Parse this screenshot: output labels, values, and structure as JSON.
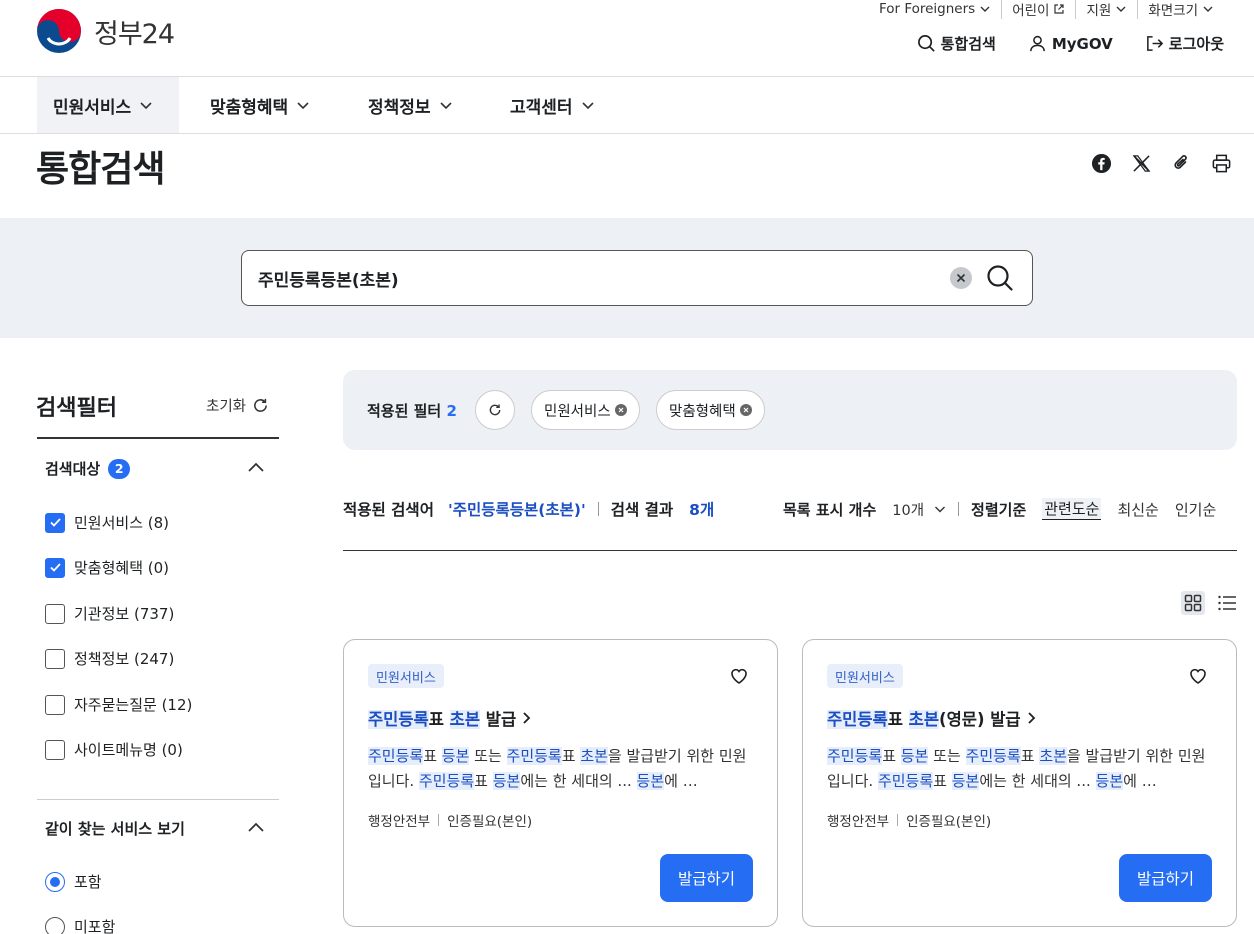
{
  "header": {
    "logo_text": "정부24",
    "utility": [
      "For Foreigners",
      "어린이",
      "지원",
      "화면크기"
    ],
    "top_nav": [
      "통합검색",
      "MyGOV",
      "로그아웃"
    ]
  },
  "gnb": [
    "민원서비스",
    "맞춤형혜택",
    "정책정보",
    "고객센터"
  ],
  "page_title": "통합검색",
  "search": {
    "value": "주민등록등본(초본)"
  },
  "sidebar": {
    "title": "검색필터",
    "reset_label": "초기화",
    "target_section": {
      "label": "검색대상",
      "count": "2",
      "options": [
        {
          "label": "민원서비스 (8)",
          "checked": true
        },
        {
          "label": "맞춤형혜택 (0)",
          "checked": true
        },
        {
          "label": "기관정보 (737)",
          "checked": false
        },
        {
          "label": "정책정보 (247)",
          "checked": false
        },
        {
          "label": "자주묻는질문 (12)",
          "checked": false
        },
        {
          "label": "사이트메뉴명 (0)",
          "checked": false
        }
      ]
    },
    "together_section": {
      "label": "같이 찾는 서비스 보기",
      "options": [
        {
          "label": "포함",
          "checked": true
        },
        {
          "label": "미포함",
          "checked": false
        }
      ]
    }
  },
  "applied_filters": {
    "label": "적용된 필터",
    "count": "2",
    "chips": [
      "민원서비스",
      "맞춤형혜택"
    ]
  },
  "result_meta": {
    "keyword_label": "적용된 검색어",
    "keyword": "'주민등록등본(초본)'",
    "result_label": "검색 결과",
    "result_count": "8개",
    "list_count_label": "목록 표시 개수",
    "list_count_value": "10개",
    "sort_label": "정렬기준",
    "sort_options": [
      "관련도순",
      "최신순",
      "인기순"
    ],
    "active_sort": "관련도순"
  },
  "cards": [
    {
      "tag": "민원서비스",
      "title_parts": [
        [
          "주민등록",
          true
        ],
        [
          "표 ",
          false
        ],
        [
          "초본",
          true
        ],
        [
          " 발급",
          false
        ]
      ],
      "desc_parts": [
        [
          "주민등록",
          true
        ],
        [
          "표 ",
          false
        ],
        [
          "등본",
          true
        ],
        [
          " 또는 ",
          false
        ],
        [
          "주민등록",
          true
        ],
        [
          "표 ",
          false
        ],
        [
          "초본",
          true
        ],
        [
          "을 발급받기 위한 민원입니다. ",
          false
        ],
        [
          "주민등록",
          true
        ],
        [
          "표 ",
          false
        ],
        [
          "등본",
          true
        ],
        [
          "에는 한 세대의 ... ",
          false
        ],
        [
          "등본",
          true
        ],
        [
          "에 …",
          false
        ]
      ],
      "agency": "행정안전부",
      "auth": "인증필요(본인)",
      "button": "발급하기"
    },
    {
      "tag": "민원서비스",
      "title_parts": [
        [
          "주민등록",
          true
        ],
        [
          "표 ",
          false
        ],
        [
          "초본",
          true
        ],
        [
          "(영문) 발급",
          false
        ]
      ],
      "desc_parts": [
        [
          "주민등록",
          true
        ],
        [
          "표 ",
          false
        ],
        [
          "등본",
          true
        ],
        [
          " 또는 ",
          false
        ],
        [
          "주민등록",
          true
        ],
        [
          "표 ",
          false
        ],
        [
          "초본",
          true
        ],
        [
          "을 발급받기 위한 민원입니다. ",
          false
        ],
        [
          "주민등록",
          true
        ],
        [
          "표 ",
          false
        ],
        [
          "등본",
          true
        ],
        [
          "에는 한 세대의 ... ",
          false
        ],
        [
          "등본",
          true
        ],
        [
          "에 …",
          false
        ]
      ],
      "agency": "행정안전부",
      "auth": "인증필요(본인)",
      "button": "발급하기"
    }
  ],
  "colors": {
    "accent": "#256ef4",
    "highlight": "#1b4ec2",
    "band": "#edf0f4"
  }
}
